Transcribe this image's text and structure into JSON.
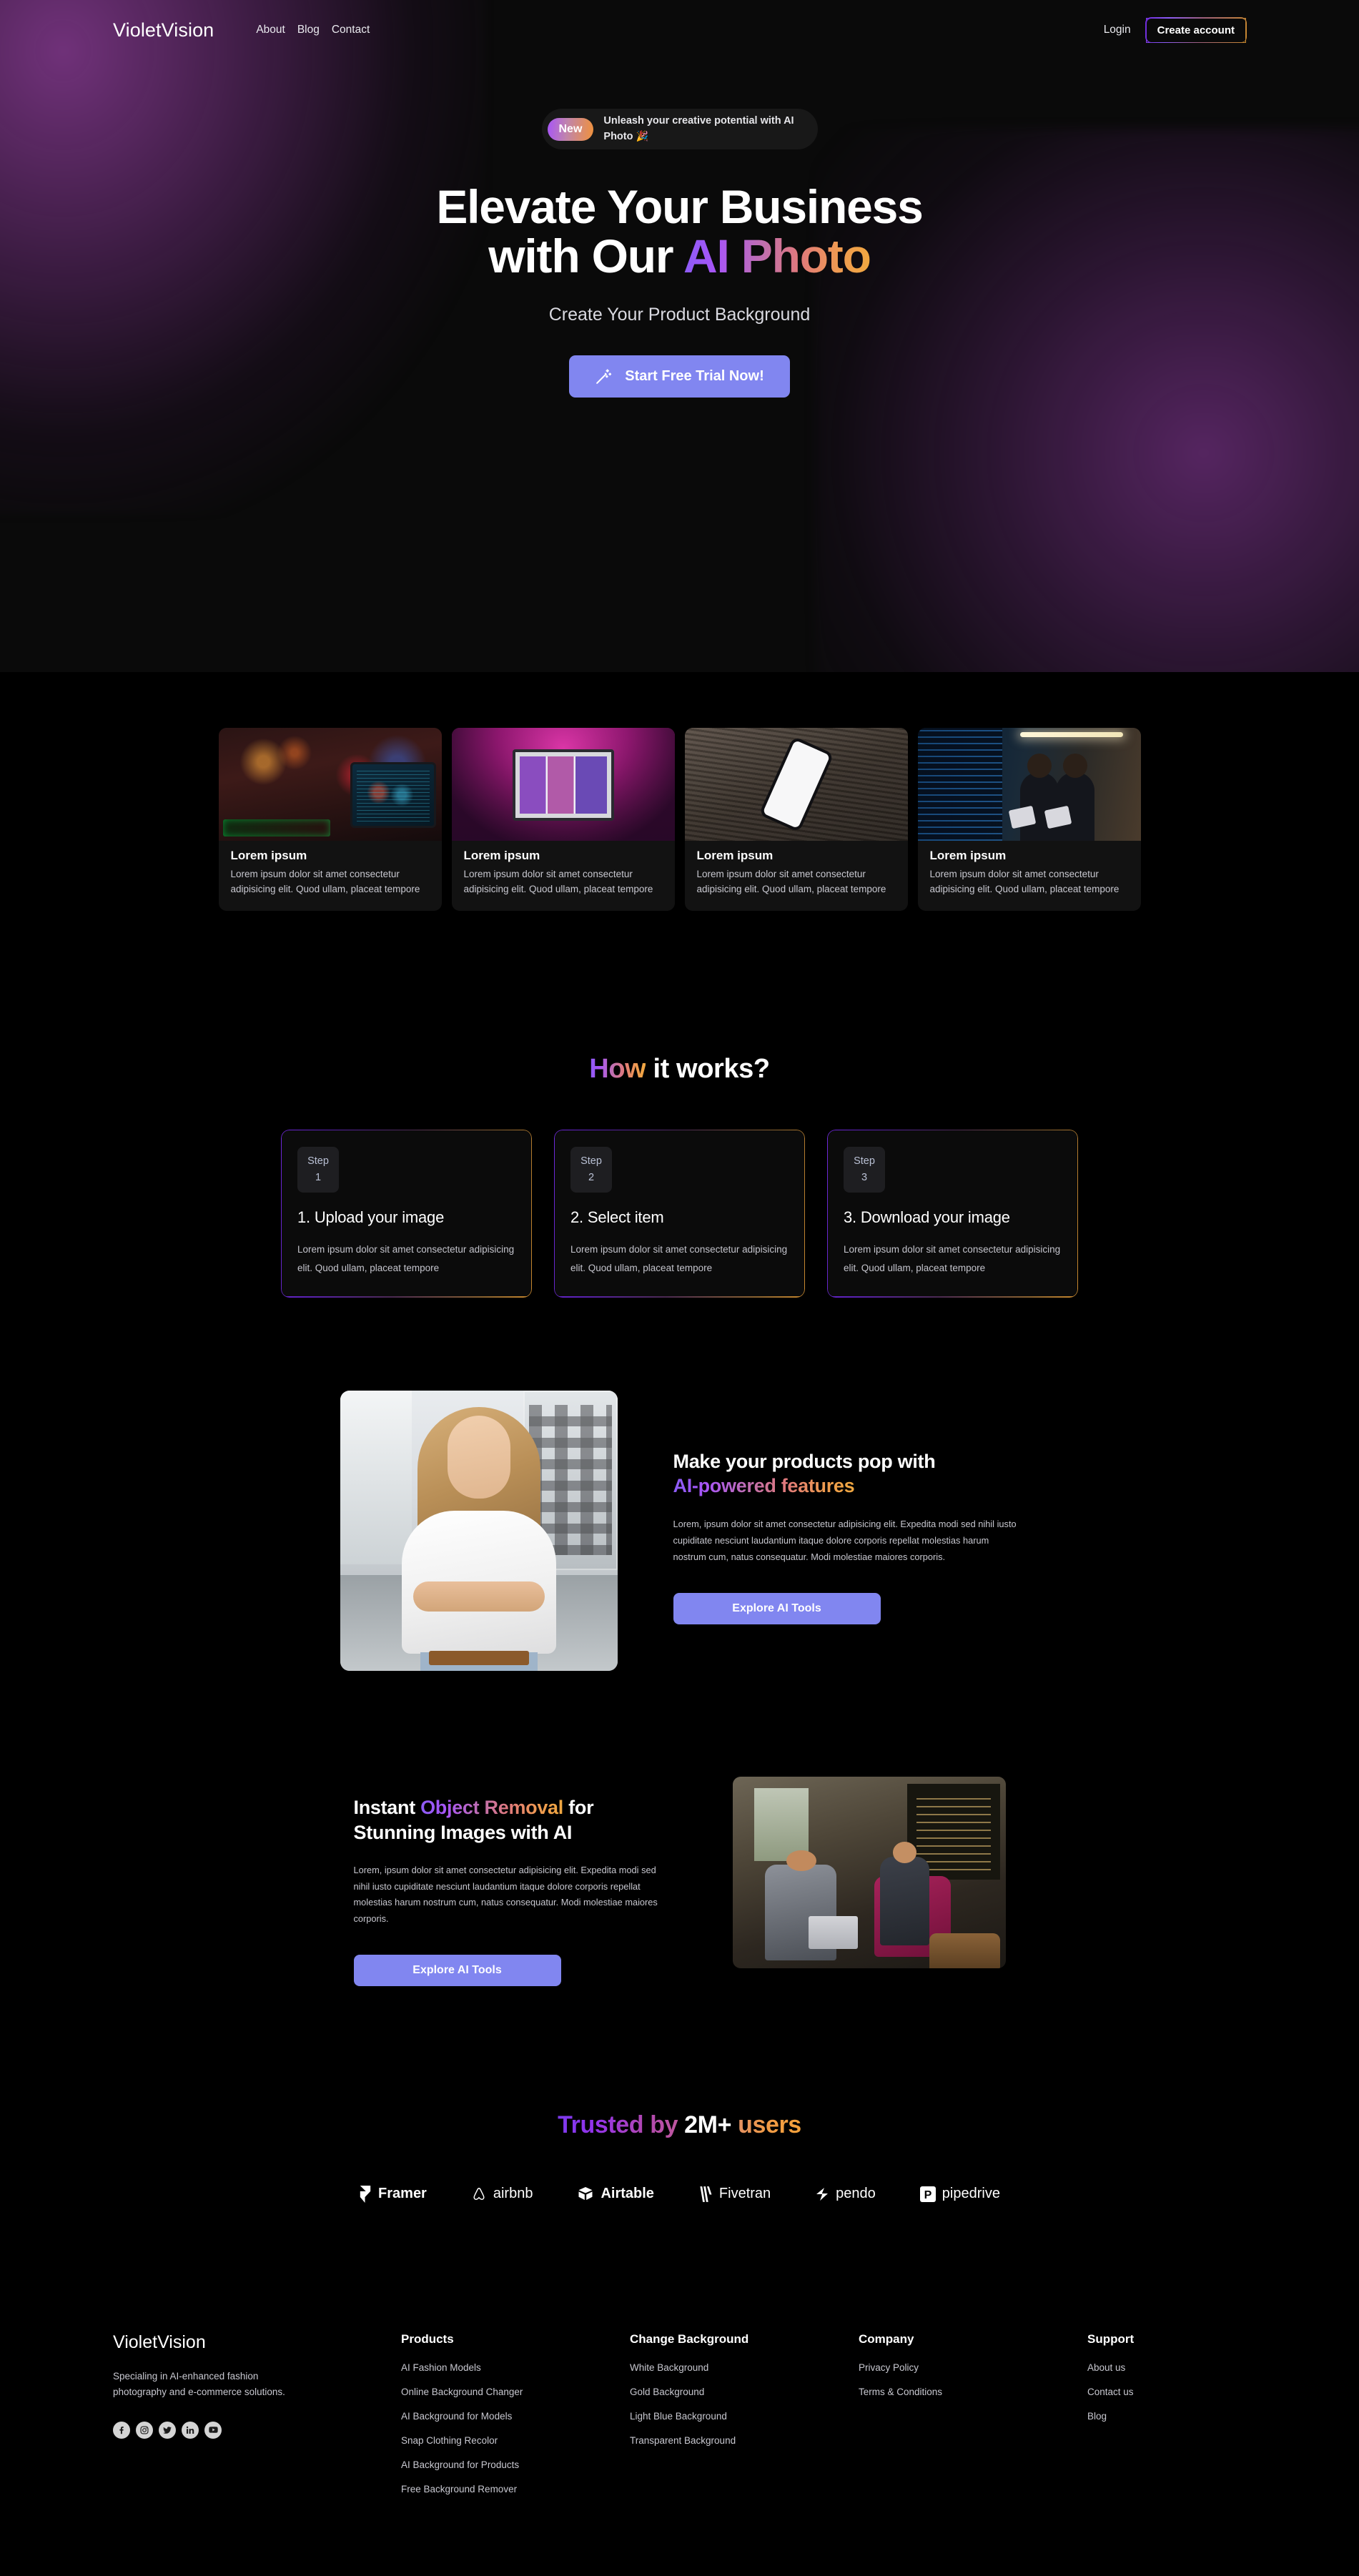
{
  "nav": {
    "brand": "VioletVision",
    "links": [
      {
        "label": "About"
      },
      {
        "label": "Blog"
      },
      {
        "label": "Contact"
      }
    ],
    "login_label": "Login",
    "create_account_label": "Create account"
  },
  "hero": {
    "badge_chip": "New",
    "badge_text": "Unleash your creative potential with AI Photo",
    "badge_emoji": "🎉",
    "title_line1": "Elevate Your Business",
    "title_line2_plain": "with Our ",
    "title_line2_accent": "AI Photo",
    "subtitle": "Create Your Product Background",
    "cta_label": "Start Free Trial Now!",
    "cta_color": "#8186f0"
  },
  "cards": [
    {
      "title": "Lorem ipsum",
      "desc": "Lorem ipsum dolor sit amet consectetur adipisicing elit. Quod ullam, placeat tempore",
      "image": "neon-studio-desk-photo"
    },
    {
      "title": "Lorem ipsum",
      "desc": "Lorem ipsum dolor sit amet consectetur adipisicing elit. Quod ullam, placeat tempore",
      "image": "pink-lit-desktop-setup-photo"
    },
    {
      "title": "Lorem ipsum",
      "desc": "Lorem ipsum dolor sit amet consectetur adipisicing elit. Quod ullam, placeat tempore",
      "image": "phone-on-wood-photo"
    },
    {
      "title": "Lorem ipsum",
      "desc": "Lorem ipsum dolor sit amet consectetur adipisicing elit. Quod ullam, placeat tempore",
      "image": "server-room-women-photo"
    }
  ],
  "how": {
    "heading_accent": "How",
    "heading_rest": " it works?",
    "steps": [
      {
        "badge_label": "Step",
        "badge_number": "1",
        "title": "1. Upload your image",
        "desc": "Lorem ipsum dolor sit amet consectetur adipisicing elit. Quod ullam, placeat tempore"
      },
      {
        "badge_label": "Step",
        "badge_number": "2",
        "title": "2. Select item",
        "desc": "Lorem ipsum dolor sit amet consectetur adipisicing elit. Quod ullam, placeat tempore"
      },
      {
        "badge_label": "Step",
        "badge_number": "3",
        "title": "3. Download your image",
        "desc": "Lorem ipsum dolor sit amet consectetur adipisicing elit. Quod ullam, placeat tempore"
      }
    ]
  },
  "feature": {
    "image": "woman-white-tshirt-city-photo",
    "title_line1": "Make your products pop with",
    "title_line2_accent": "AI-powered features",
    "body": "Lorem, ipsum dolor sit amet consectetur adipisicing elit. Expedita modi sed nihil iusto cupiditate nesciunt laudantium itaque dolore corporis repellat molestias harum nostrum cum, natus consequatur. Modi molestiae maiores corporis.",
    "button_label": "Explore AI Tools"
  },
  "removal": {
    "title_pre": "Instant ",
    "title_accent": "Object Removal",
    "title_post": " for",
    "title_line2": "Stunning Images with AI",
    "body": "Lorem, ipsum dolor sit amet consectetur adipisicing elit. Expedita modi sed nihil iusto cupiditate nesciunt laudantium itaque dolore corporis repellat molestias harum nostrum cum, natus consequatur. Modi molestiae maiores corporis.",
    "button_label": "Explore AI Tools",
    "image": "cafe-two-men-laptop-photo"
  },
  "trusted": {
    "heading_accent": "Trusted by ",
    "heading_count": "2M+",
    "heading_suffix": " users",
    "logos": [
      {
        "name": "Framer",
        "icon": "framer-icon"
      },
      {
        "name": "airbnb",
        "icon": "airbnb-icon"
      },
      {
        "name": "Airtable",
        "icon": "airtable-icon"
      },
      {
        "name": "Fivetran",
        "icon": "fivetran-icon"
      },
      {
        "name": "pendo",
        "icon": "pendo-icon"
      },
      {
        "name": "pipedrive",
        "icon": "pipedrive-icon"
      }
    ]
  },
  "footer": {
    "brand": "VioletVision",
    "tagline": "Specialing in AI-enhanced fashion photography and e-commerce solutions.",
    "social": [
      {
        "name": "facebook-icon"
      },
      {
        "name": "instagram-icon"
      },
      {
        "name": "twitter-icon"
      },
      {
        "name": "linkedin-icon"
      },
      {
        "name": "youtube-icon"
      }
    ],
    "columns": [
      {
        "heading": "Products",
        "links": [
          "AI Fashion Models",
          "Online Background Changer",
          "AI Background for Models",
          "Snap Clothing Recolor",
          "AI Background for Products",
          "Free Background Remover"
        ]
      },
      {
        "heading": "Change Background",
        "links": [
          "White Background",
          "Gold Background",
          "Light Blue Background",
          "Transparent Background"
        ]
      },
      {
        "heading": "Company",
        "links": [
          "Privacy Policy",
          "Terms & Conditions"
        ]
      },
      {
        "heading": "Support",
        "links": [
          "About us",
          "Contact us",
          "Blog"
        ]
      }
    ]
  },
  "theme": {
    "background": "#000000",
    "accent_purple": "#8b5cf6",
    "accent_orange": "#f0a840",
    "button_blue": "#8186f0",
    "text_primary": "#ffffff",
    "text_muted": "#c8c8d0"
  }
}
